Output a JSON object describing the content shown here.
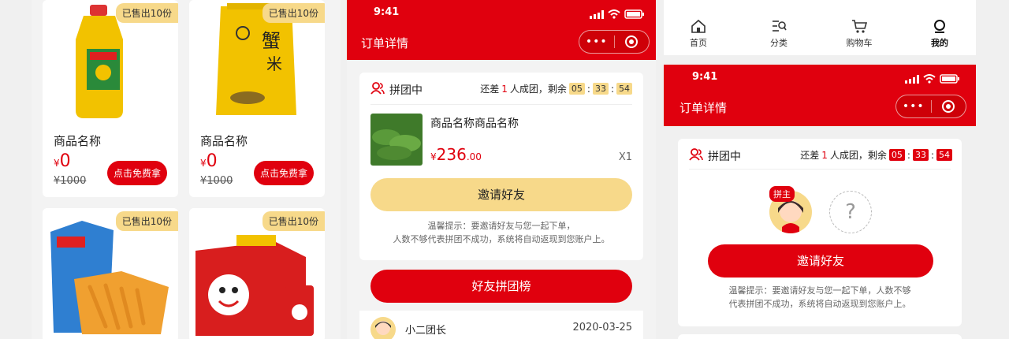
{
  "left": {
    "products": [
      {
        "sold": "已售出10份",
        "name": "商品名称",
        "price": "0",
        "currency": "¥",
        "orig": "¥1000",
        "btn": "点击免费拿"
      },
      {
        "sold": "已售出10份",
        "name": "商品名称",
        "price": "0",
        "currency": "¥",
        "orig": "¥1000",
        "btn": "点击免费拿"
      },
      {
        "sold": "已售出10份"
      },
      {
        "sold": "已售出10份"
      }
    ]
  },
  "middle": {
    "time": "9:41",
    "title": "订单详情",
    "status": "拼团中",
    "countdown_prefix": "还差",
    "count": "1",
    "countdown_suffix": "人成团，剩余",
    "t1": "05",
    "t2": "33",
    "t3": "54",
    "product_name": "商品名称商品名称",
    "currency": "¥",
    "price_int": "236",
    "price_dec": ".00",
    "qty": "X1",
    "invite": "邀请好友",
    "tip_line1": "温馨提示：要邀请好友与您一起下单，",
    "tip_line2": "人数不够代表拼团不成功，系统将自动返现到您账户上。",
    "ranking": "好友拼团榜",
    "member_name": "小二团长",
    "member_date": "2020-03-25"
  },
  "right": {
    "tabs": [
      {
        "label": "首页"
      },
      {
        "label": "分类"
      },
      {
        "label": "购物车"
      },
      {
        "label": "我的"
      }
    ],
    "time": "9:41",
    "title": "订单详情",
    "status": "拼团中",
    "countdown_prefix": "还差",
    "count": "1",
    "countdown_suffix": "人成团，剩余",
    "t1": "05",
    "t2": "33",
    "t3": "54",
    "leader": "拼主",
    "unknown": "?",
    "invite": "邀请好友",
    "tip_line1": "温馨提示：要邀请好友与您一起下单，人数不够",
    "tip_line2": "代表拼团不成功，系统将自动返现到您账户上。"
  },
  "colors": {
    "accent": "#e0000e",
    "gold": "#f7d98a"
  }
}
